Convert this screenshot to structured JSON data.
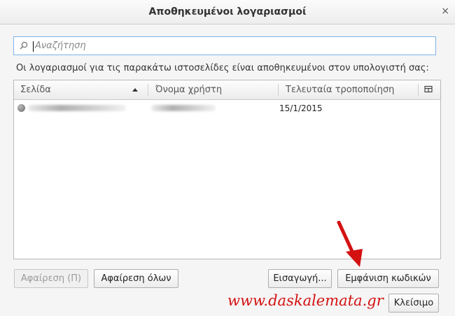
{
  "window": {
    "title": "Αποθηκευμένοι λογαριασμοί",
    "close_glyph": "×"
  },
  "search": {
    "placeholder": "Αναζήτηση",
    "icon": "search-icon"
  },
  "info_text": "Οι λογαριασμοί για τις παρακάτω ιστοσελίδες είναι αποθηκευμένοι στον υπολογιστή σας:",
  "table": {
    "columns": [
      "Σελίδα",
      "Όνομα χρήστη",
      "Τελευταία τροποποίηση"
    ],
    "sort_column": "Σελίδα",
    "sort_direction": "ascending",
    "rows": [
      {
        "site_icon": "globe-icon",
        "site": "[blurred]",
        "username": "[blurred]",
        "last_modified": "15/1/2015"
      }
    ]
  },
  "buttons": {
    "remove": "Αφαίρεση (Π)",
    "remove_all": "Αφαίρεση όλων",
    "import": "Εισαγωγή...",
    "show_passwords": "Εμφάνιση κωδικών",
    "close": "Κλείσιμο"
  },
  "watermark": "www.daskalemata.gr",
  "colors": {
    "watermark": "#d41111",
    "arrow": "#d41111",
    "search_border": "#7eb4ea"
  }
}
